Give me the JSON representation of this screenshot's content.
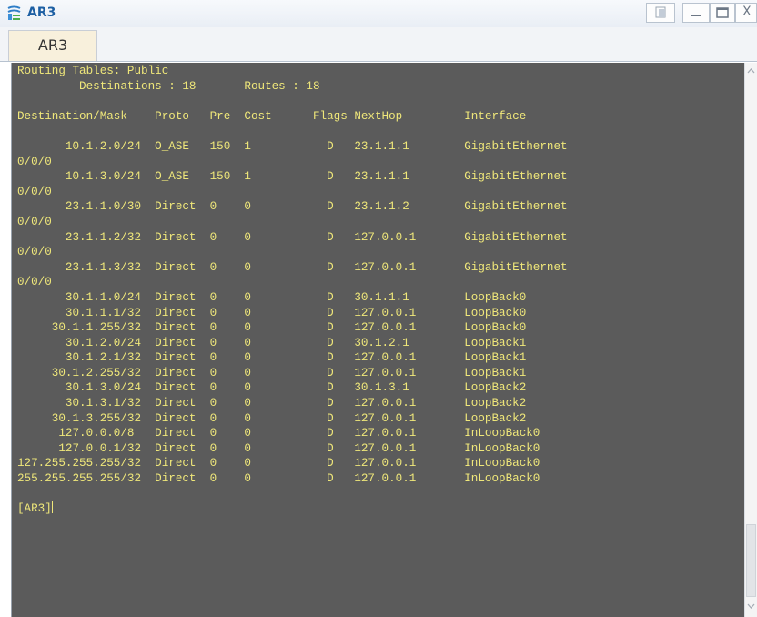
{
  "window": {
    "title": "AR3",
    "controls": {
      "restore": "restore",
      "minimize": "minimize",
      "maximize": "maximize",
      "close": "X"
    },
    "icons": {
      "app": "router-app-icon"
    }
  },
  "tabs": [
    {
      "label": "AR3",
      "active": true
    }
  ],
  "terminal": {
    "lines": [
      "Routing Tables: Public",
      "         Destinations : 18       Routes : 18",
      "",
      "Destination/Mask    Proto   Pre  Cost      Flags NextHop         Interface",
      "",
      "       10.1.2.0/24  O_ASE   150  1           D   23.1.1.1        GigabitEthernet",
      "0/0/0",
      "       10.1.3.0/24  O_ASE   150  1           D   23.1.1.1        GigabitEthernet",
      "0/0/0",
      "       23.1.1.0/30  Direct  0    0           D   23.1.1.2        GigabitEthernet",
      "0/0/0",
      "       23.1.1.2/32  Direct  0    0           D   127.0.0.1       GigabitEthernet",
      "0/0/0",
      "       23.1.1.3/32  Direct  0    0           D   127.0.0.1       GigabitEthernet",
      "0/0/0",
      "       30.1.1.0/24  Direct  0    0           D   30.1.1.1        LoopBack0",
      "       30.1.1.1/32  Direct  0    0           D   127.0.0.1       LoopBack0",
      "     30.1.1.255/32  Direct  0    0           D   127.0.0.1       LoopBack0",
      "       30.1.2.0/24  Direct  0    0           D   30.1.2.1        LoopBack1",
      "       30.1.2.1/32  Direct  0    0           D   127.0.0.1       LoopBack1",
      "     30.1.2.255/32  Direct  0    0           D   127.0.0.1       LoopBack1",
      "       30.1.3.0/24  Direct  0    0           D   30.1.3.1        LoopBack2",
      "       30.1.3.1/32  Direct  0    0           D   127.0.0.1       LoopBack2",
      "     30.1.3.255/32  Direct  0    0           D   127.0.0.1       LoopBack2",
      "      127.0.0.0/8   Direct  0    0           D   127.0.0.1       InLoopBack0",
      "      127.0.0.1/32  Direct  0    0           D   127.0.0.1       InLoopBack0",
      "127.255.255.255/32  Direct  0    0           D   127.0.0.1       InLoopBack0",
      "255.255.255.255/32  Direct  0    0           D   127.0.0.1       InLoopBack0",
      "",
      "[AR3]"
    ],
    "text_color": "#efe77a",
    "background": "#5b5b5b"
  },
  "scrollbar": {
    "icons": {
      "up": "scroll-up-icon",
      "down": "scroll-down-icon"
    }
  }
}
